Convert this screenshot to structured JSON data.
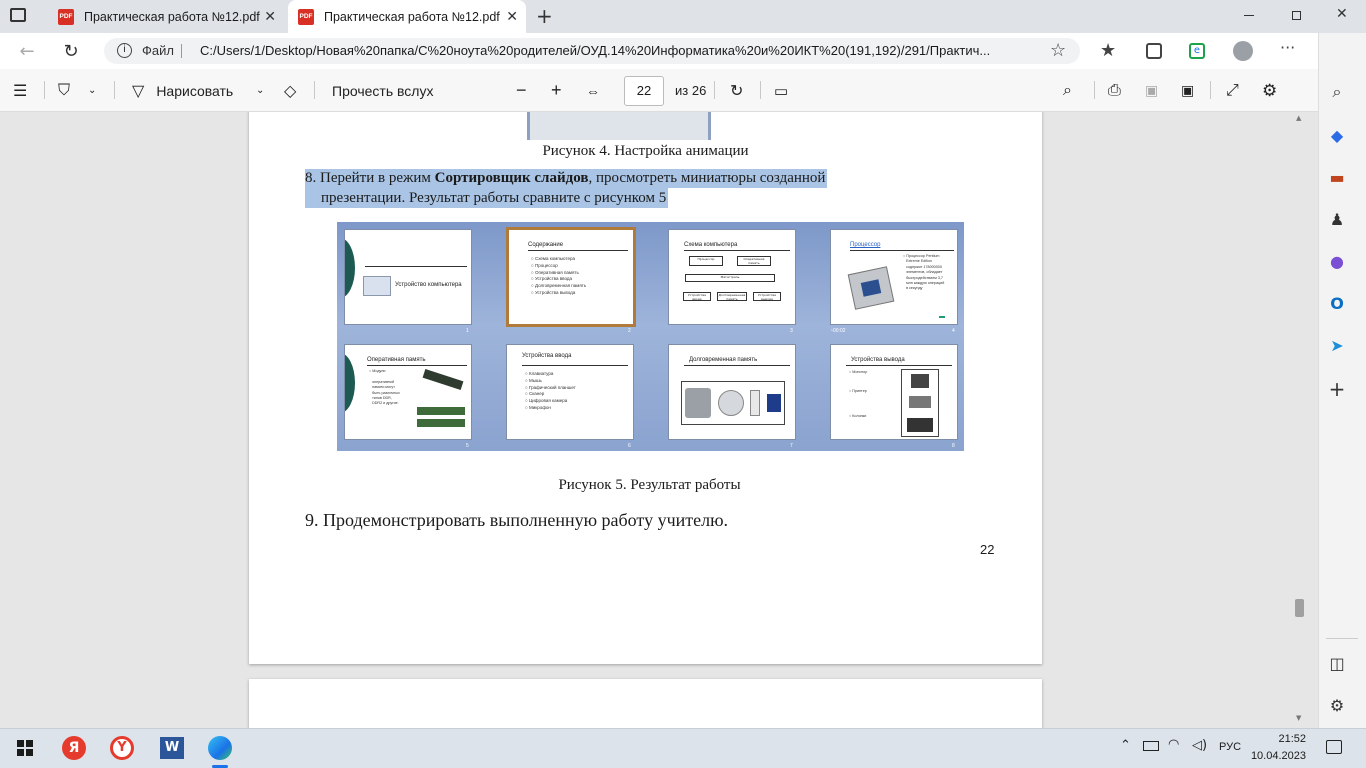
{
  "tabs": [
    {
      "label": "Практическая работа №12.pdf",
      "active": false
    },
    {
      "label": "Практическая работа №12.pdf",
      "active": true
    }
  ],
  "address": {
    "site_label": "Файл",
    "url": "C:/Users/1/Desktop/Новая%20папка/С%20ноута%20родителей/ОУД.14%20Информатика%20и%20ИКТ%20(191,192)/291/Практич..."
  },
  "pdf_toolbar": {
    "draw_label": "Нарисовать",
    "read_aloud_label": "Прочесть вслух",
    "page_current": "22",
    "page_total": "из 26"
  },
  "document": {
    "fig4_caption": "Рисунок 4. Настройка анимации",
    "step8_prefix": "8. Перейти в режим ",
    "step8_bold": "Сортировщик слайдов",
    "step8_rest": ", просмотреть миниатюры созданной",
    "step8_line2": "презентации. Результат работы сравните с рисунком 5",
    "fig5_caption": "Рисунок 5. Результат работы",
    "step9": "9. Продемонстрировать выполненную работу учителю.",
    "page_number": "22"
  },
  "slides": [
    {
      "num": "1",
      "title": "Устройство компьютера",
      "bullets": ""
    },
    {
      "num": "2",
      "title": "Содержание",
      "bullets": "○ Схема компьютера\n○ Процессор\n○ Оперативная память\n○ Устройства ввода\n○ Долговременная память\n○ Устройства вывода"
    },
    {
      "num": "3",
      "title": "Схема компьютера",
      "bullets": ""
    },
    {
      "num": "4",
      "title": "Процессор",
      "bullets": "○ Процессор Pentium\n   Extreme Edition\n   содержит 178000000\n   элементов, обладает\n   быстродействием 3,7\n   млн каждую операций\n   в секунду",
      "timing": "00:02"
    },
    {
      "num": "5",
      "title": "Оперативная память",
      "bullets": "○ Модули\n\n   оперативной\n   памяти могут\n   быть различных\n   типов DDR,\n   DDR2 и другие."
    },
    {
      "num": "6",
      "title": "Устройства ввода",
      "bullets": "○ Клавиатура\n○ Мышь\n○ Графический планшет\n○ Сканер\n○ Цифровая камера\n○ Микрофон"
    },
    {
      "num": "7",
      "title": "Долговременная память",
      "bullets": ""
    },
    {
      "num": "8",
      "title": "Устройства вывода",
      "bullets": "○ Монитор\n\n\n○ Принтер\n\n\n\n○ Колонки"
    }
  ],
  "slide3_boxes": [
    "Процессор",
    "Оперативная память",
    "Магистраль",
    "Устройства ввода",
    "Долговременная память",
    "Устройства вывода"
  ],
  "taskbar": {
    "time": "21:52",
    "date": "10.04.2023",
    "lang": "РУС"
  }
}
